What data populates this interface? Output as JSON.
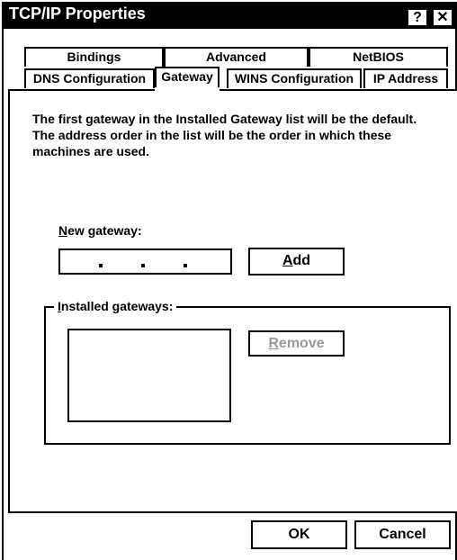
{
  "window": {
    "title": "TCP/IP Properties",
    "help_glyph": "?",
    "close_glyph": "✕"
  },
  "tabs": {
    "row1": [
      {
        "label": "Bindings"
      },
      {
        "label": "Advanced"
      },
      {
        "label": "NetBIOS"
      }
    ],
    "row2": [
      {
        "label": "DNS Configuration"
      },
      {
        "label": "Gateway",
        "active": true
      },
      {
        "label": "WINS Configuration"
      },
      {
        "label": "IP Address"
      }
    ]
  },
  "gateway_page": {
    "description_lines": [
      "The first gateway in the Installed Gateway list will be the default.",
      "The address order in the list will be the order in which these",
      "machines are used."
    ],
    "new_gateway": {
      "label_accel": "N",
      "label_rest": "ew gateway:",
      "ip_value": "",
      "ip_dots": [
        ".",
        ".",
        "."
      ]
    },
    "add_button": {
      "accel": "A",
      "rest": "dd"
    },
    "installed_gateways": {
      "label_accel": "I",
      "label_rest": "nstalled gateways:",
      "items": []
    },
    "remove_button": {
      "accel": "R",
      "rest": "emove",
      "enabled": false
    }
  },
  "footer": {
    "ok_label": "OK",
    "cancel_label": "Cancel"
  },
  "colors": {
    "titlebar_bg": "#000000",
    "titlebar_text": "#ffffff",
    "background": "#ffffff",
    "disabled_text": "#9a9a9a"
  }
}
